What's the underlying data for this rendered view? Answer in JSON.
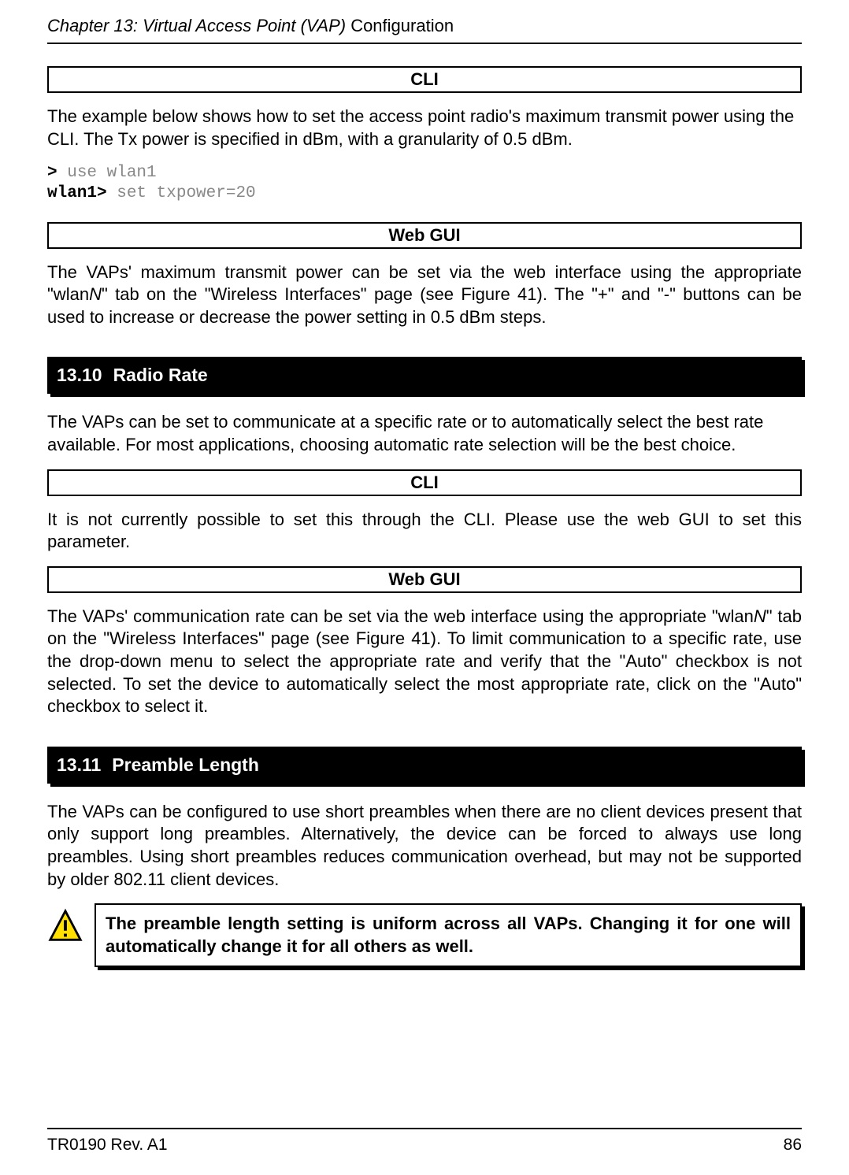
{
  "header": {
    "chapter_italic": "Chapter 13: Virtual Access Point (VAP) ",
    "chapter_normal": "Configuration"
  },
  "section1": {
    "box1_label": "CLI",
    "para1": "The example below shows how to set the access point radio's maximum transmit power using the CLI. The Tx power is specified in dBm, with a granularity of 0.5 dBm.",
    "cli_prompt1": ">",
    "cli_cmd1": " use wlan1",
    "cli_prompt2": "wlan1>",
    "cli_cmd2": " set txpower=20",
    "box2_label": "Web GUI",
    "para2_a": "The VAPs' maximum transmit power can be set via the web interface using the appropriate \"wlan",
    "para2_n": "N",
    "para2_b": "\" tab on the \"Wireless Interfaces\" page (see Figure 41). The \"+\" and \"-\" buttons can be used to increase or decrease the power setting in 0.5 dBm steps."
  },
  "section2": {
    "number": "13.10",
    "title": "Radio Rate",
    "para1": "The VAPs can be set to communicate at a specific rate or to automatically select the best rate available. For most applications, choosing automatic rate selection will be the best choice.",
    "box1_label": "CLI",
    "para2": "It is not currently possible to set this through the CLI. Please use the web GUI to set this parameter.",
    "box2_label": "Web GUI",
    "para3_a": "The VAPs' communication rate can be set via the web interface using the appropriate \"wlan",
    "para3_n": "N",
    "para3_b": "\" tab on the \"Wireless Interfaces\" page (see Figure 41). To limit communication to a specific rate, use the drop-down menu to select the appropriate rate and verify that the \"Auto\" checkbox is not selected. To set the device to automatically select the most appropriate rate, click on the \"Auto\" checkbox to select it."
  },
  "section3": {
    "number": "13.11",
    "title": "Preamble Length",
    "para1": "The VAPs can be configured to use short preambles when there are no client devices present that only support long preambles. Alternatively, the device can be forced to always use long preambles. Using short preambles reduces communication overhead, but may not be supported by older 802.11 client devices.",
    "warning": "The preamble length setting is uniform across all VAPs. Changing it for one will automatically change it for all others as well."
  },
  "footer": {
    "left": "TR0190 Rev. A1",
    "right": "86"
  }
}
